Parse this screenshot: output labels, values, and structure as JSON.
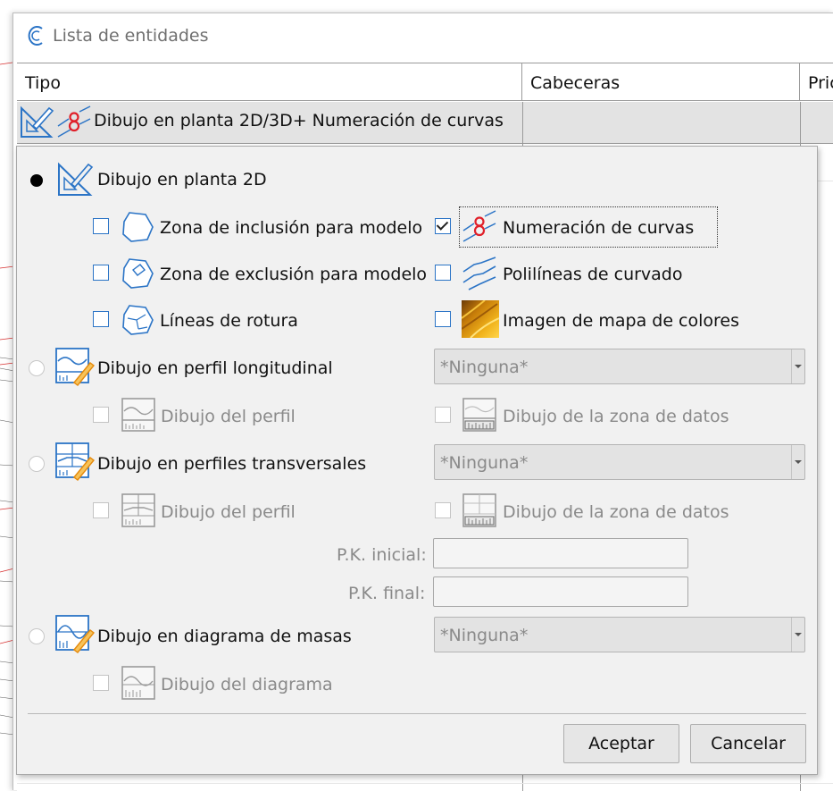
{
  "window": {
    "title": "Lista de entidades"
  },
  "table": {
    "headers": [
      "Tipo",
      "Cabeceras",
      "Pric"
    ],
    "row1_text": "Dibujo en planta 2D/3D+ Numeración de curvas"
  },
  "popup": {
    "planta": {
      "label": "Dibujo en planta 2D",
      "options": {
        "inclusion": "Zona de inclusión para modelo",
        "exclusion": "Zona de exclusión para modelo",
        "rotura": "Líneas de rotura",
        "numeracion": "Numeración de curvas",
        "polilineas": "Polilíneas de curvado",
        "imagen": "Imagen de mapa de colores"
      }
    },
    "longitudinal": {
      "label": "Dibujo en perfil longitudinal",
      "combo": "*Ninguna*",
      "perfil": "Dibujo del perfil",
      "zona_datos": "Dibujo de la zona de datos"
    },
    "transversales": {
      "label": "Dibujo en perfiles transversales",
      "combo": "*Ninguna*",
      "perfil": "Dibujo del perfil",
      "zona_datos": "Dibujo de la zona de datos",
      "pk_inicial": "P.K. inicial:",
      "pk_final": "P.K. final:",
      "pk_inicial_value": "",
      "pk_final_value": ""
    },
    "masas": {
      "label": "Dibujo en diagrama de masas",
      "combo": "*Ninguna*",
      "diagrama": "Dibujo del diagrama"
    },
    "buttons": {
      "ok": "Aceptar",
      "cancel": "Cancelar"
    }
  },
  "colors": {
    "accent": "#2b74c6",
    "red": "#e0202a",
    "row_selected": "#e3e3e3"
  }
}
